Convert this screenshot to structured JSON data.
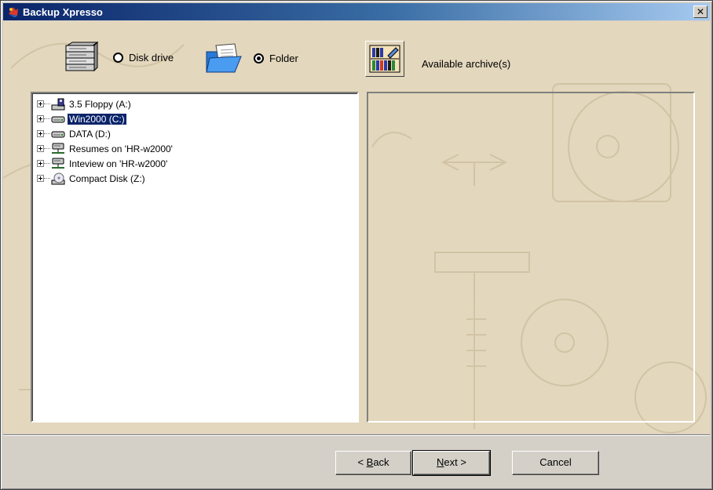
{
  "window": {
    "title": "Backup Xpresso",
    "close_glyph": "✕"
  },
  "source_options": [
    {
      "icon": "disk-drive-icon",
      "label": "Disk drive",
      "selected": false
    },
    {
      "icon": "folder-icon",
      "label": "Folder",
      "selected": true
    }
  ],
  "archives": {
    "icon": "archive-shelf-icon",
    "label": "Available archive(s)"
  },
  "tree": {
    "items": [
      {
        "icon": "floppy-drive-icon",
        "label": "3.5 Floppy (A:)",
        "selected": false
      },
      {
        "icon": "hard-drive-icon",
        "label": "Win2000 (C:)",
        "selected": true
      },
      {
        "icon": "hard-drive-icon",
        "label": "DATA (D:)",
        "selected": false
      },
      {
        "icon": "network-drive-icon",
        "label": "Resumes on 'HR-w2000'",
        "selected": false
      },
      {
        "icon": "network-drive-icon",
        "label": "Inteview on 'HR-w2000'",
        "selected": false
      },
      {
        "icon": "cd-drive-icon",
        "label": "Compact Disk (Z:)",
        "selected": false
      }
    ]
  },
  "buttons": {
    "back": {
      "prefix": "< ",
      "accel": "B",
      "rest": "ack"
    },
    "next": {
      "accel": "N",
      "rest": "ext >"
    },
    "cancel": "Cancel"
  },
  "colors": {
    "title_gradient_start": "#0a246a",
    "title_gradient_end": "#a6caf0",
    "background_parchment": "#e3d7bd",
    "selection": "#0a246a"
  }
}
